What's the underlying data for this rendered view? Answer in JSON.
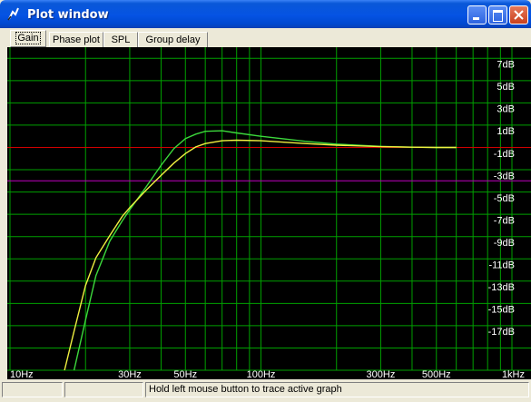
{
  "window": {
    "title": "Plot window"
  },
  "tabs": [
    {
      "label": "Gain",
      "active": true
    },
    {
      "label": "Phase plot",
      "active": false
    },
    {
      "label": "SPL",
      "active": false
    },
    {
      "label": "Group delay",
      "active": false
    }
  ],
  "status": {
    "pane1": "",
    "pane2": "",
    "message": "Hold left mouse button to trace active graph"
  },
  "colors": {
    "background": "#000000",
    "grid": "#00a000",
    "reference_line": "#d00000",
    "marker_line": "#c000c0",
    "curve_green": "#3cd83c",
    "curve_yellow": "#f0f040",
    "labels": "#ffffff"
  },
  "chart_data": {
    "type": "line",
    "xscale": "log",
    "xlim": [
      10,
      1000
    ],
    "ylim": [
      -20,
      9
    ],
    "x_tick_labels": [
      {
        "x": 10,
        "label": "10Hz"
      },
      {
        "x": 30,
        "label": "30Hz"
      },
      {
        "x": 50,
        "label": "50Hz"
      },
      {
        "x": 100,
        "label": "100Hz"
      },
      {
        "x": 300,
        "label": "300Hz"
      },
      {
        "x": 500,
        "label": "500Hz"
      },
      {
        "x": 1000,
        "label": "1kHz"
      }
    ],
    "y_tick_labels": [
      {
        "y": 7,
        "label": "7dB"
      },
      {
        "y": 5,
        "label": "5dB"
      },
      {
        "y": 3,
        "label": "3dB"
      },
      {
        "y": 1,
        "label": "1dB"
      },
      {
        "y": -1,
        "label": "-1dB"
      },
      {
        "y": -3,
        "label": "-3dB"
      },
      {
        "y": -5,
        "label": "-5dB"
      },
      {
        "y": -7,
        "label": "-7dB"
      },
      {
        "y": -9,
        "label": "-9dB"
      },
      {
        "y": -11,
        "label": "-11dB"
      },
      {
        "y": -13,
        "label": "-13dB"
      },
      {
        "y": -15,
        "label": "-15dB"
      },
      {
        "y": -17,
        "label": "-17dB"
      }
    ],
    "reference_lines": [
      {
        "y": 0,
        "color": "#d00000"
      },
      {
        "y": -3,
        "color": "#c000c0"
      }
    ],
    "series": [
      {
        "color": "#3cd83c",
        "x": [
          18,
          20,
          22,
          25,
          28,
          30,
          35,
          40,
          45,
          50,
          55,
          60,
          70,
          80,
          100,
          150,
          200,
          300,
          400,
          500,
          600
        ],
        "y": [
          -20,
          -15.5,
          -11.5,
          -8.4,
          -6.6,
          -5.6,
          -3.5,
          -1.6,
          -0.1,
          0.8,
          1.2,
          1.45,
          1.5,
          1.3,
          1.0,
          0.55,
          0.3,
          0.1,
          0.02,
          0.0,
          0.0
        ]
      },
      {
        "color": "#f0f040",
        "x": [
          16.5,
          18,
          20,
          22,
          25,
          28,
          30,
          35,
          40,
          45,
          50,
          55,
          60,
          70,
          80,
          100,
          150,
          200,
          300,
          400,
          500,
          600
        ],
        "y": [
          -20,
          -16.5,
          -12.4,
          -9.9,
          -7.9,
          -6.2,
          -5.4,
          -3.8,
          -2.5,
          -1.4,
          -0.55,
          0.05,
          0.35,
          0.6,
          0.65,
          0.6,
          0.35,
          0.2,
          0.07,
          0.02,
          0.0,
          0.0
        ]
      }
    ]
  }
}
